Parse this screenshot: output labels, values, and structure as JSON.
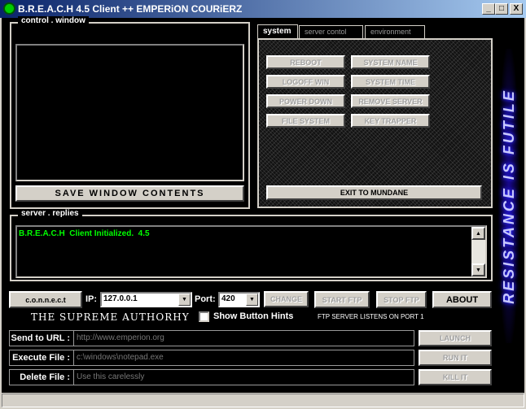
{
  "window": {
    "title": "B.R.E.A.C.H 4.5 Client ++ EMPERiON COURiERZ",
    "minimize": "_",
    "maximize": "□",
    "close": "X"
  },
  "control_window": {
    "legend": "control . window",
    "save_button": "SAVE WINDOW CONTENTS"
  },
  "tabs": [
    {
      "label": "system",
      "active": true
    },
    {
      "label": "server contol",
      "active": false
    },
    {
      "label": "environment",
      "active": false
    }
  ],
  "system_buttons": [
    "REBOOT",
    "SYSTEM NAME",
    "LOGOFF WIN",
    "SYSTEM TIME",
    "POWER DOWN",
    "REMOVE SERVER",
    "FILE SYSTEM",
    "KEY TRAPPER"
  ],
  "exit_button": "EXIT TO MUNDANE",
  "server_replies": {
    "legend": "server . replies",
    "text": "B.R.E.A.C.H  Client Initialized.  4.5",
    "text_color": "#00ff00"
  },
  "connection": {
    "connect_button": "c.o.n.n.e.c.t",
    "ip_label": "IP:",
    "ip_value": "127.0.0.1",
    "port_label": "Port:",
    "port_value": "420",
    "change": "CHANGE",
    "start_ftp": "START FTP",
    "stop_ftp": "STOP FTP",
    "about": "ABOUT"
  },
  "tagline": "THE SUPREME AUTHORHY",
  "show_hints": {
    "label": "Show Button Hints",
    "checked": false
  },
  "ftp_note": "FTP SERVER LISTENS ON PORT 1",
  "actions": [
    {
      "label": "Send to URL :",
      "value": "http://www.emperion.org",
      "button": "LAUNCH"
    },
    {
      "label": "Execute File :",
      "value": "c:\\windows\\notepad.exe",
      "button": "RUN IT"
    },
    {
      "label": "Delete File :",
      "value": "Use this carelessly",
      "button": "KILL IT"
    }
  ],
  "banner": "RESISTANCE IS FUTILE",
  "banner_color": "#2a1aff"
}
